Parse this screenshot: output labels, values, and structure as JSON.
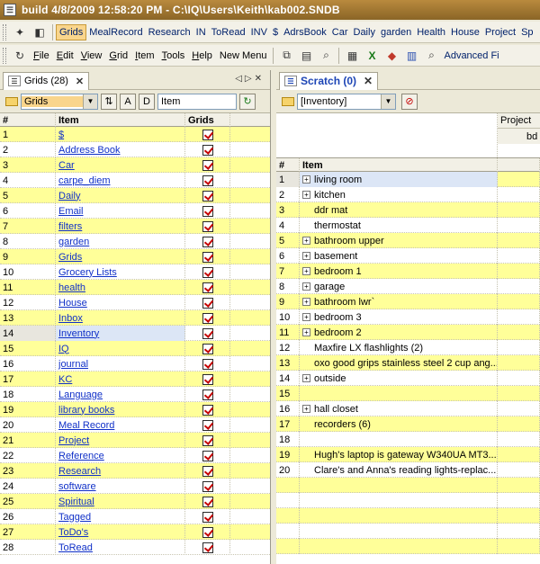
{
  "window": {
    "title": "build 4/8/2009 12:58:20 PM - C:\\IQ\\Users\\Keith\\kab002.SNDB"
  },
  "quicklinks": [
    "Grids",
    "MealRecord",
    "Research",
    "IN",
    "ToRead",
    "INV",
    "$",
    "AdrsBook",
    "Car",
    "Daily",
    "garden",
    "Health",
    "House",
    "Project",
    "Sp"
  ],
  "menu": {
    "items": [
      {
        "first": "F",
        "rest": "ile"
      },
      {
        "first": "E",
        "rest": "dit"
      },
      {
        "first": "V",
        "rest": "iew"
      },
      {
        "first": "G",
        "rest": "rid"
      },
      {
        "first": "I",
        "rest": "tem"
      },
      {
        "first": "T",
        "rest": "ools"
      },
      {
        "first": "H",
        "rest": "elp"
      }
    ],
    "new_menu": "New Menu",
    "advanced_label": "Advanced Fi"
  },
  "left_panel": {
    "tab_label": "Grids (28)",
    "grid_combo": "Grids",
    "sort_a": "A",
    "sort_d": "D",
    "field_value": "Item",
    "columns": {
      "num": "#",
      "item": "Item",
      "grids": "Grids"
    },
    "rows": [
      {
        "n": "1",
        "item": "$"
      },
      {
        "n": "2",
        "item": "Address Book"
      },
      {
        "n": "3",
        "item": "Car"
      },
      {
        "n": "4",
        "item": "carpe_diem"
      },
      {
        "n": "5",
        "item": "Daily"
      },
      {
        "n": "6",
        "item": "Email"
      },
      {
        "n": "7",
        "item": "filters"
      },
      {
        "n": "8",
        "item": "garden"
      },
      {
        "n": "9",
        "item": "Grids"
      },
      {
        "n": "10",
        "item": "Grocery Lists"
      },
      {
        "n": "11",
        "item": "health"
      },
      {
        "n": "12",
        "item": "House"
      },
      {
        "n": "13",
        "item": "Inbox"
      },
      {
        "n": "14",
        "item": "Inventory"
      },
      {
        "n": "15",
        "item": "IQ"
      },
      {
        "n": "16",
        "item": "journal"
      },
      {
        "n": "17",
        "item": "KC"
      },
      {
        "n": "18",
        "item": "Language"
      },
      {
        "n": "19",
        "item": "library books"
      },
      {
        "n": "20",
        "item": "Meal Record"
      },
      {
        "n": "21",
        "item": "Project"
      },
      {
        "n": "22",
        "item": "Reference"
      },
      {
        "n": "23",
        "item": "Research"
      },
      {
        "n": "24",
        "item": "software"
      },
      {
        "n": "25",
        "item": "Spiritual"
      },
      {
        "n": "26",
        "item": "Tagged"
      },
      {
        "n": "27",
        "item": "ToDo's"
      },
      {
        "n": "28",
        "item": "ToRead"
      }
    ]
  },
  "right_panel": {
    "tab_label": "Scratch (0)",
    "grid_combo": "[Inventory]",
    "columns": {
      "num": "#",
      "item": "Item",
      "project": "Project",
      "sub": "bd"
    },
    "rows": [
      {
        "n": "1",
        "item": "living room",
        "plus": true,
        "selected": true
      },
      {
        "n": "2",
        "item": "kitchen",
        "plus": true
      },
      {
        "n": "3",
        "item": "ddr mat",
        "indent": true
      },
      {
        "n": "4",
        "item": "thermostat",
        "indent": true
      },
      {
        "n": "5",
        "item": "bathroom upper",
        "plus": true
      },
      {
        "n": "6",
        "item": "basement",
        "plus": true
      },
      {
        "n": "7",
        "item": "bedroom 1",
        "plus": true
      },
      {
        "n": "8",
        "item": "garage",
        "plus": true
      },
      {
        "n": "9",
        "item": "bathroom lwr`",
        "plus": true
      },
      {
        "n": "10",
        "item": "bedroom 3",
        "plus": true
      },
      {
        "n": "11",
        "item": "bedroom 2",
        "plus": true
      },
      {
        "n": "12",
        "item": "Maxfire LX flashlights (2)",
        "indent": true
      },
      {
        "n": "13",
        "item": "oxo good grips stainless steel 2 cup ang...",
        "indent": true
      },
      {
        "n": "14",
        "item": "outside",
        "plus": true
      },
      {
        "n": "15",
        "item": ""
      },
      {
        "n": "16",
        "item": "hall closet",
        "plus": true
      },
      {
        "n": "17",
        "item": "recorders (6)",
        "indent": true
      },
      {
        "n": "18",
        "item": ""
      },
      {
        "n": "19",
        "item": "Hugh's laptop is gateway W340UA  MT3...",
        "indent": true
      },
      {
        "n": "20",
        "item": "Clare's and Anna's reading lights-replac...",
        "indent": true
      },
      {
        "n": "",
        "item": ""
      },
      {
        "n": "",
        "item": ""
      },
      {
        "n": "",
        "item": ""
      },
      {
        "n": "",
        "item": ""
      },
      {
        "n": "",
        "item": ""
      }
    ]
  }
}
